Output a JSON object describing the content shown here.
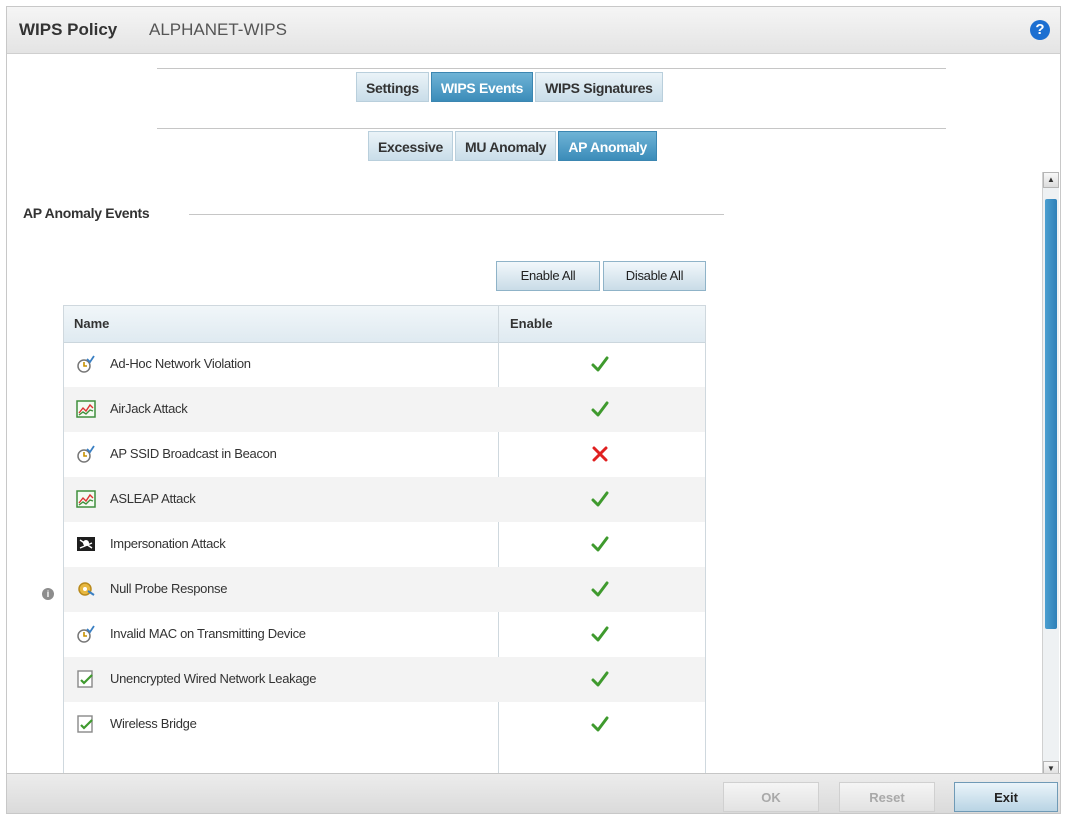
{
  "header": {
    "title": "WIPS Policy",
    "subtitle": "ALPHANET-WIPS",
    "help_glyph": "?"
  },
  "primary_tabs": [
    {
      "label": "Settings",
      "active": false
    },
    {
      "label": "WIPS Events",
      "active": true
    },
    {
      "label": "WIPS Signatures",
      "active": false
    }
  ],
  "secondary_tabs": [
    {
      "label": "Excessive",
      "active": false
    },
    {
      "label": "MU Anomaly",
      "active": false
    },
    {
      "label": "AP Anomaly",
      "active": true
    }
  ],
  "section": {
    "title": "AP Anomaly Events"
  },
  "actions": {
    "enable_all": "Enable All",
    "disable_all": "Disable All"
  },
  "table": {
    "columns": [
      "Name",
      "Enable"
    ],
    "rows": [
      {
        "name": "Ad-Hoc Network Violation",
        "enabled": true,
        "icon": "clock-signal-icon"
      },
      {
        "name": "AirJack Attack",
        "enabled": true,
        "icon": "chart-icon"
      },
      {
        "name": "AP SSID Broadcast in Beacon",
        "enabled": false,
        "icon": "clock-signal-icon"
      },
      {
        "name": "ASLEAP Attack",
        "enabled": true,
        "icon": "chart-icon"
      },
      {
        "name": "Impersonation Attack",
        "enabled": true,
        "icon": "pirate-flag-icon"
      },
      {
        "name": "Null Probe Response",
        "enabled": true,
        "icon": "gear-arrow-icon"
      },
      {
        "name": "Invalid MAC on Transmitting Device",
        "enabled": true,
        "icon": "clock-signal-icon"
      },
      {
        "name": "Unencrypted Wired Network Leakage",
        "enabled": true,
        "icon": "document-check-icon"
      },
      {
        "name": "Wireless Bridge",
        "enabled": true,
        "icon": "document-check-icon"
      }
    ]
  },
  "footer": {
    "ok_label": "OK",
    "reset_label": "Reset",
    "exit_label": "Exit"
  },
  "colors": {
    "accent": "#3b8cb9",
    "check": "#3f9a2e",
    "cross": "#e02020"
  }
}
